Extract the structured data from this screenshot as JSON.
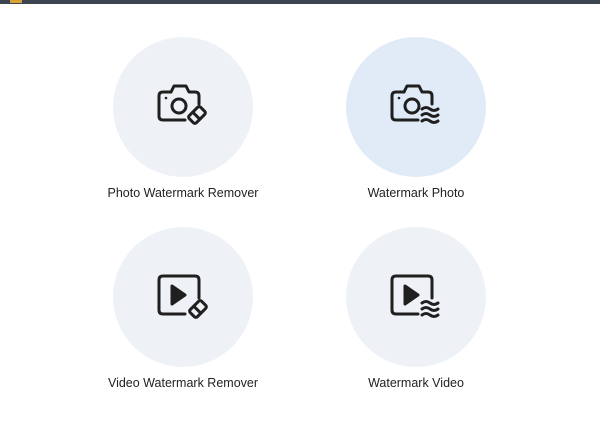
{
  "tools": [
    {
      "label": "Photo Watermark Remover",
      "icon": "camera-eraser-icon",
      "selected": false
    },
    {
      "label": "Watermark Photo",
      "icon": "camera-watermark-icon",
      "selected": true
    },
    {
      "label": "Video Watermark Remover",
      "icon": "video-eraser-icon",
      "selected": false
    },
    {
      "label": "Watermark Video",
      "icon": "video-watermark-icon",
      "selected": false
    }
  ],
  "colors": {
    "circle": "#eef1f6",
    "circle_selected": "#e1ebf7",
    "icon": "#1f1f1f",
    "topbar": "#3c4452"
  }
}
